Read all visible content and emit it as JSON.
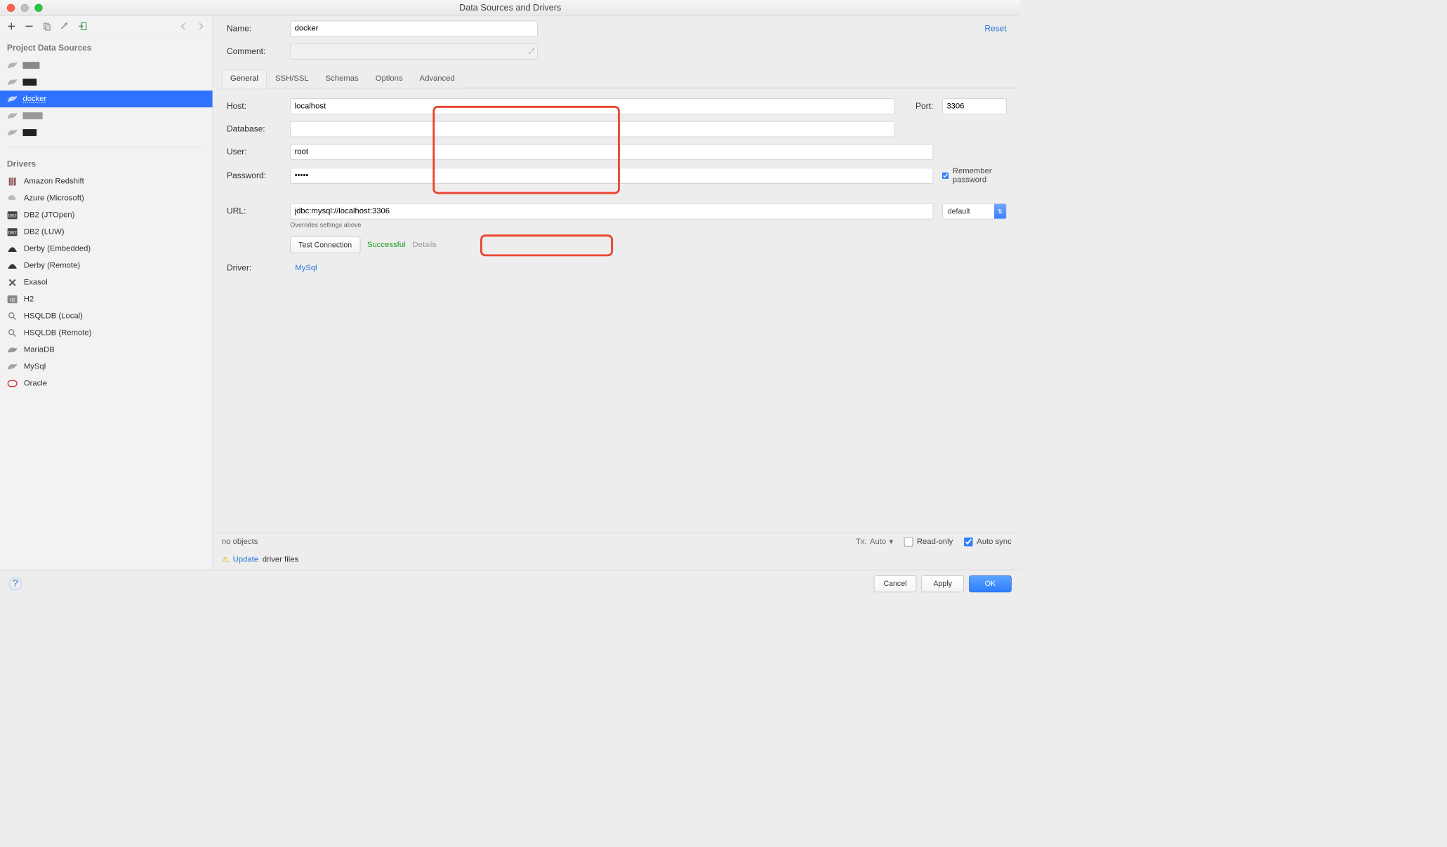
{
  "window": {
    "title": "Data Sources and Drivers"
  },
  "reset_label": "Reset",
  "form": {
    "name_label": "Name:",
    "name_value": "docker",
    "comment_label": "Comment:",
    "host_label": "Host:",
    "host_value": "localhost",
    "port_label": "Port:",
    "port_value": "3306",
    "database_label": "Database:",
    "database_value": "",
    "user_label": "User:",
    "user_value": "root",
    "password_label": "Password:",
    "password_value": "•••••",
    "remember_label": "Remember password",
    "remember_checked": true,
    "url_label": "URL:",
    "url_value": "jdbc:mysql://localhost:3306",
    "url_mode": "default",
    "url_hint": "Overrides settings above",
    "test_label": "Test Connection",
    "test_status": "Successful",
    "details_label": "Details",
    "driver_label": "Driver:",
    "driver_value": "MySql"
  },
  "tabs": {
    "items": [
      "General",
      "SSH/SSL",
      "Schemas",
      "Options",
      "Advanced"
    ],
    "active": 0
  },
  "sidebar": {
    "section_sources": "Project Data Sources",
    "section_drivers": "Drivers",
    "sources": [
      {
        "label": "",
        "redact": "grey"
      },
      {
        "label": "",
        "redact": "dark"
      },
      {
        "label": "docker",
        "selected": true
      },
      {
        "label": "",
        "redact": "light"
      },
      {
        "label": "",
        "redact": "dark"
      }
    ],
    "drivers": [
      {
        "label": "Amazon Redshift",
        "icon": "redshift"
      },
      {
        "label": "Azure (Microsoft)",
        "icon": "azure"
      },
      {
        "label": "DB2 (JTOpen)",
        "icon": "db2"
      },
      {
        "label": "DB2 (LUW)",
        "icon": "db2"
      },
      {
        "label": "Derby (Embedded)",
        "icon": "derby"
      },
      {
        "label": "Derby (Remote)",
        "icon": "derby"
      },
      {
        "label": "Exasol",
        "icon": "exasol"
      },
      {
        "label": "H2",
        "icon": "h2"
      },
      {
        "label": "HSQLDB (Local)",
        "icon": "hsql"
      },
      {
        "label": "HSQLDB (Remote)",
        "icon": "hsql"
      },
      {
        "label": "MariaDB",
        "icon": "maria"
      },
      {
        "label": "MySql",
        "icon": "mysql"
      },
      {
        "label": "Oracle",
        "icon": "oracle"
      }
    ]
  },
  "content_bottom": {
    "no_objects": "no objects",
    "tx_label": "Tx:",
    "tx_value": "Auto",
    "readonly_label": "Read-only",
    "readonly_checked": false,
    "autosync_label": "Auto sync",
    "autosync_checked": true,
    "update_link": "Update",
    "update_rest": "driver files"
  },
  "footer": {
    "cancel": "Cancel",
    "apply": "Apply",
    "ok": "OK"
  }
}
